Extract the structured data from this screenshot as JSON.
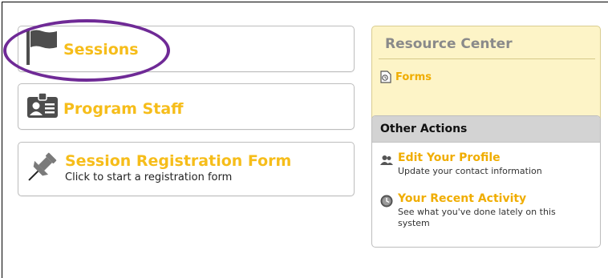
{
  "cards": {
    "sessions": {
      "label": "Sessions"
    },
    "program_staff": {
      "label": "Program Staff"
    },
    "registration": {
      "label": "Session Registration Form",
      "description": "Click to start a registration form"
    }
  },
  "resource_center": {
    "title": "Resource Center",
    "forms_label": "Forms"
  },
  "other_actions": {
    "title": "Other Actions",
    "edit_profile": {
      "label": "Edit Your Profile",
      "description": "Update your contact information"
    },
    "recent_activity": {
      "label": "Your Recent Activity",
      "description_line1": "See what you've done lately on this",
      "description_line2": "system"
    }
  },
  "colors": {
    "accent": "#f6bd1a",
    "highlight_oval": "#6f2a96",
    "resource_bg": "#fdf4c7",
    "actions_header_bg": "#d3d3d3"
  },
  "icons": {
    "sessions": "flag-icon",
    "program_staff": "id-badge-icon",
    "registration": "pushpin-icon",
    "forms": "document-icon",
    "edit_profile": "users-icon",
    "recent_activity": "clock-icon"
  }
}
